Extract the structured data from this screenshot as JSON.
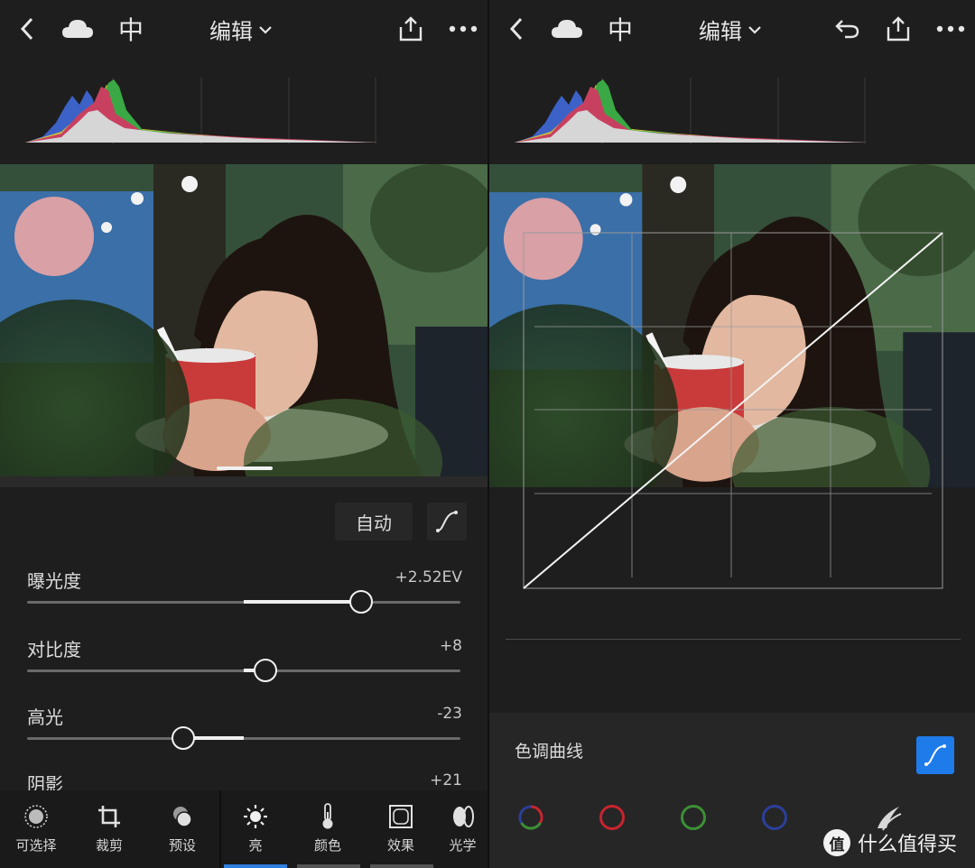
{
  "left": {
    "topbar": {
      "lang": "中",
      "title": "编辑",
      "icons": [
        "back-icon",
        "cloud-icon",
        "share-icon",
        "more-icon"
      ]
    },
    "auto_label": "自动",
    "sliders": [
      {
        "label": "曝光度",
        "value": "+2.52EV",
        "position": 0.77,
        "center": 0.5
      },
      {
        "label": "对比度",
        "value": "+8",
        "position": 0.55,
        "center": 0.5
      },
      {
        "label": "高光",
        "value": "-23",
        "position": 0.36,
        "center": 0.5
      },
      {
        "label": "阴影",
        "value": "+21"
      }
    ],
    "nav": [
      {
        "label": "可选择",
        "icon": "selective-icon"
      },
      {
        "label": "裁剪",
        "icon": "crop-icon"
      },
      {
        "label": "预设",
        "icon": "presets-icon"
      },
      {
        "label": "亮",
        "icon": "light-icon",
        "active": true
      },
      {
        "label": "颜色",
        "icon": "thermometer-icon"
      },
      {
        "label": "效果",
        "icon": "effects-icon"
      },
      {
        "label": "光学",
        "icon": "optics-icon"
      }
    ]
  },
  "right": {
    "topbar": {
      "lang": "中",
      "title": "编辑",
      "icons": [
        "back-icon",
        "cloud-icon",
        "undo-icon",
        "share-icon",
        "more-icon"
      ]
    },
    "tone_curve_label": "色调曲线",
    "channels": [
      {
        "name": "rgb",
        "color": "#c84040"
      },
      {
        "name": "red",
        "color": "#c8242f"
      },
      {
        "name": "green",
        "color": "#3c8f36"
      },
      {
        "name": "blue",
        "color": "#2c3f9a"
      }
    ],
    "watermark": "什么值得买",
    "watermark_badge": "值"
  },
  "colors": {
    "accent": "#1e7bea",
    "active_tab": "#2f7fe0"
  }
}
